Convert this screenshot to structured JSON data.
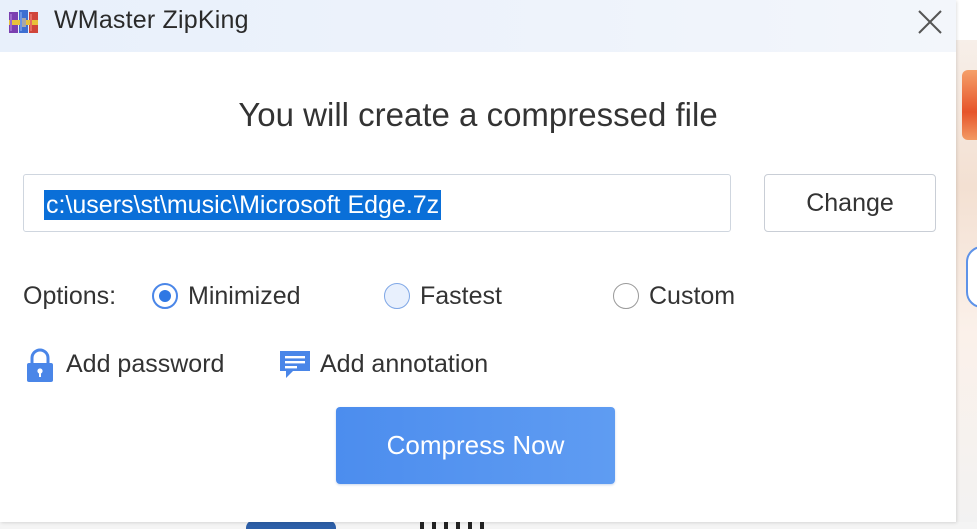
{
  "window": {
    "title": "WMaster ZipKing",
    "app_icon": "winrar-books-icon",
    "close_icon": "close-icon"
  },
  "main": {
    "heading": "You will create a compressed file",
    "path_value": "c:\\users\\st\\music\\Microsoft Edge.7z",
    "change_label": "Change"
  },
  "options": {
    "label": "Options:",
    "choices": [
      {
        "label": "Minimized",
        "selected": true
      },
      {
        "label": "Fastest",
        "selected": false
      },
      {
        "label": "Custom",
        "selected": false
      }
    ]
  },
  "extras": {
    "password_label": "Add password",
    "password_icon": "lock-icon",
    "annotation_label": "Add annotation",
    "annotation_icon": "comment-icon"
  },
  "actions": {
    "compress_label": "Compress Now"
  },
  "colors": {
    "accent": "#4c8dee",
    "selection": "#0a6fd8",
    "titlebar": "#e8f0fb"
  }
}
